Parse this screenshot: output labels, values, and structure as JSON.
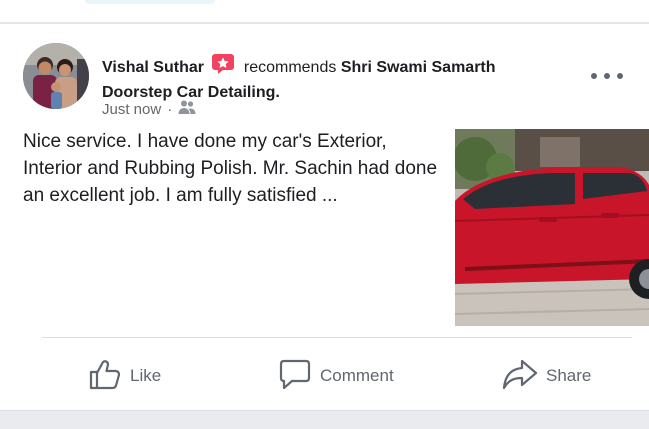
{
  "post": {
    "author": "Vishal Suthar",
    "verb": "recommends",
    "page_name": "Shri Swami Samarth Doorstep Car Detailing.",
    "time": "Just now",
    "separator": "·",
    "audience_icon": "friends-icon",
    "text": "Nice service. I have done my car's Exterior, Interior and Rubbing Polish. Mr. Sachin had done an excellent job. I am fully satisfied ...",
    "recommend_badge_color": "#f3425f"
  },
  "actions": {
    "like_label": "Like",
    "comment_label": "Comment",
    "share_label": "Share"
  },
  "colors": {
    "text": "#1c1e21",
    "secondary": "#65676b",
    "divider": "#dadde1",
    "car": "#c8152a"
  }
}
